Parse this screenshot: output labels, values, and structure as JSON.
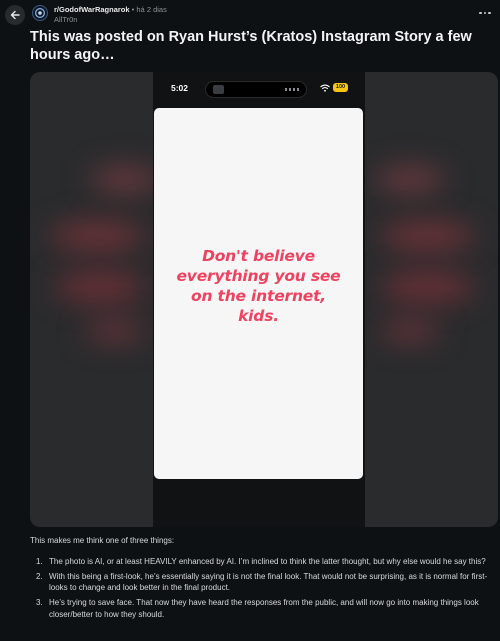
{
  "header": {
    "subreddit": "r/GodofWarRagnarok",
    "separator": "•",
    "time": "há 2 dias",
    "author": "AllTr0n"
  },
  "post": {
    "title": "This was posted on Ryan Hurst’s (Kratos) Instagram Story a few hours ago…"
  },
  "media": {
    "status_time": "5:02",
    "battery": "100",
    "story_text": "Don't believe\neverything you see\non the internet,\nkids.",
    "story_text_color": "#ee4360"
  },
  "body": {
    "intro": "This makes me think one of three things:",
    "items": [
      {
        "num": "1.",
        "text": "The photo is AI, or at least HEAVILY enhanced by AI. I’m inclined to think the latter thought, but why else would he say this?"
      },
      {
        "num": "2.",
        "text": "With this being a first-look, he’s essentially saying it is not the final look. That would not be surprising, as it is normal for first-looks to change and look better in the final product."
      },
      {
        "num": "3.",
        "text": "He’s trying to save face. That now they have heard the responses from the public, and will now go into making things look closer/better to how they should."
      }
    ]
  },
  "icons": {
    "back": "arrow-left-icon",
    "more": "more-horizontal-icon",
    "wifi": "wifi-icon"
  },
  "colors": {
    "background": "#0e1113",
    "accent_yellow": "#f5c518"
  }
}
